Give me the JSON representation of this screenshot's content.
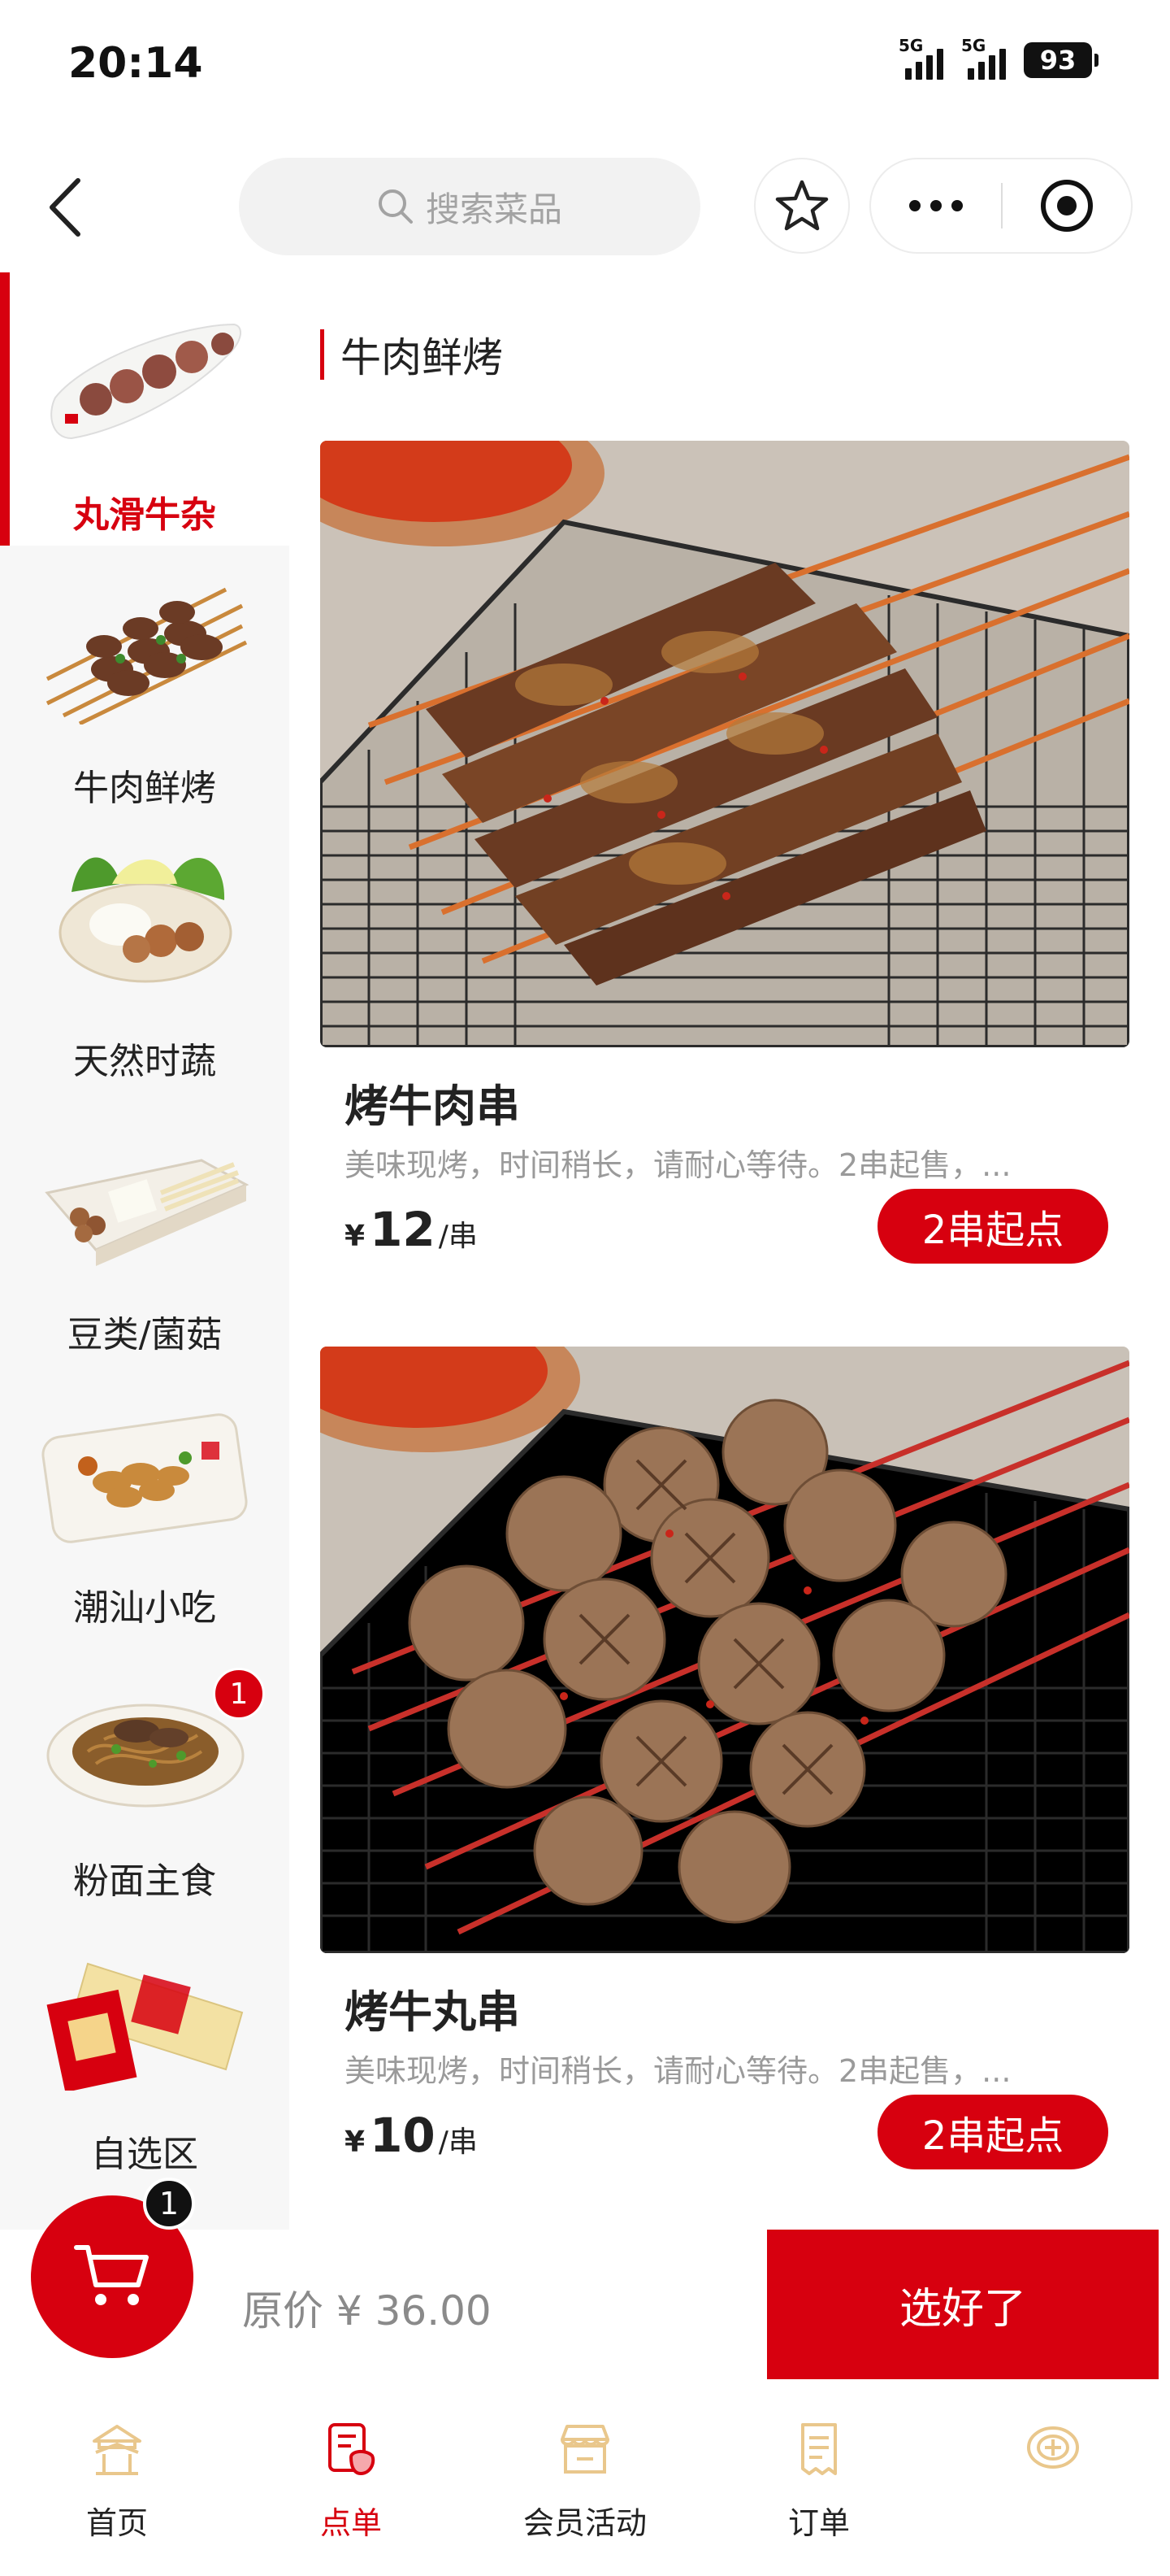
{
  "status_bar": {
    "time": "20:14",
    "signal_1": "5G",
    "signal_2": "5G",
    "battery": "93"
  },
  "header": {
    "search_placeholder": "搜索菜品",
    "back_icon": "chevron-left-icon",
    "favorite_icon": "star-icon",
    "more_icon": "more-dots-icon",
    "target_icon": "target-icon"
  },
  "sidebar": {
    "items": [
      {
        "label": "丸滑牛杂",
        "active": true
      },
      {
        "label": "牛肉鲜烤",
        "active": false
      },
      {
        "label": "天然时蔬",
        "active": false
      },
      {
        "label": "豆类/菌菇",
        "active": false
      },
      {
        "label": "潮汕小吃",
        "active": false
      },
      {
        "label": "粉面主食",
        "active": false,
        "badge": "1"
      },
      {
        "label": "自选区",
        "active": false
      }
    ]
  },
  "section": {
    "title": "牛肉鲜烤"
  },
  "products": [
    {
      "name": "烤牛肉串",
      "desc": "美味现烤，时间稍长，请耐心等待。2串起售，...",
      "currency": "¥",
      "price": "12",
      "unit": "/串",
      "button": "2串起点"
    },
    {
      "name": "烤牛丸串",
      "desc": "美味现烤，时间稍长，请耐心等待。2串起售，...",
      "currency": "¥",
      "price": "10",
      "unit": "/串",
      "button": "2串起点"
    }
  ],
  "cart": {
    "badge": "1",
    "price_text": "原价 ¥ 36.00",
    "checkout": "选好了"
  },
  "tabs": [
    {
      "label": "首页",
      "icon": "home-pavilion-icon",
      "active": false
    },
    {
      "label": "点单",
      "icon": "order-menu-icon",
      "active": true
    },
    {
      "label": "会员活动",
      "icon": "shop-icon",
      "active": false
    },
    {
      "label": "订单",
      "icon": "receipt-icon",
      "active": false
    },
    {
      "label": "",
      "icon": "brand-logo-icon",
      "active": false
    }
  ],
  "colors": {
    "accent": "#d7000f",
    "tab_inactive_icon": "#e9c78c"
  }
}
